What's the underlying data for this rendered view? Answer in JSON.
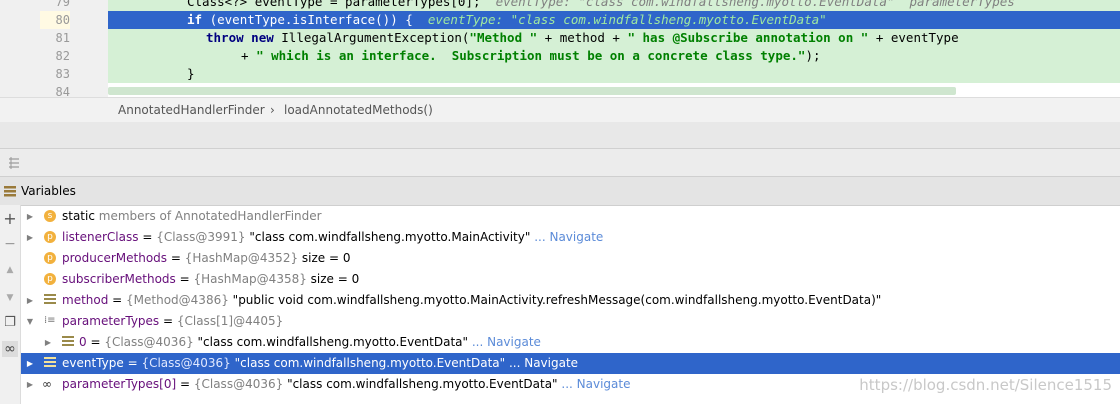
{
  "editor": {
    "lines": [
      {
        "num": "79",
        "code": "Class<?> eventType = parameterTypes[0];",
        "hint": "eventType: \"class com.windfallsheng.myotto.EventData\"  parameterTypes"
      },
      {
        "num": "80",
        "kw": "if",
        "code": " (eventType.isInterface()) {",
        "hint": "eventType: \"class com.windfallsheng.myotto.EventData\""
      },
      {
        "num": "81",
        "kw1": "throw",
        "kw2": "new",
        "pre": " IllegalArgumentException(",
        "s1": "\"Method \"",
        "mid": " + method + ",
        "s2": "\" has @Subscribe annotation on \"",
        "post": " + eventType"
      },
      {
        "num": "82",
        "pre": "+ ",
        "s1": "\" which is an interface.  Subscription must be on a concrete class type.\"",
        "post": ");"
      },
      {
        "num": "83",
        "code": "}"
      },
      {
        "num": "84",
        "code": ""
      }
    ]
  },
  "breadcrumb": {
    "class_name": "AnnotatedHandlerFinder",
    "separator": "›",
    "method_name": "loadAnnotatedMethods()"
  },
  "panel": {
    "title": "Variables"
  },
  "sidebar": {
    "add": "+",
    "remove": "−",
    "up": "▲",
    "down": "▼",
    "copy": "❐",
    "watch": "∞"
  },
  "variables": [
    {
      "icon": "s",
      "static_label": "static",
      "text": " members of AnnotatedHandlerFinder"
    },
    {
      "icon": "p",
      "name": "listenerClass",
      "eq": " = ",
      "ref": "{Class@3991}",
      "value": " \"class com.windfallsheng.myotto.MainActivity\"",
      "nav": " ... Navigate"
    },
    {
      "icon": "p",
      "name": "producerMethods",
      "eq": " = ",
      "ref": "{HashMap@4352}",
      "value": "  size = 0"
    },
    {
      "icon": "p",
      "name": "subscriberMethods",
      "eq": " = ",
      "ref": "{HashMap@4358}",
      "value": "  size = 0"
    },
    {
      "icon": "f",
      "name": "method",
      "eq": " = ",
      "ref": "{Method@4386}",
      "value": " \"public void com.windfallsheng.myotto.MainActivity.refreshMessage(com.windfallsheng.myotto.EventData)\""
    },
    {
      "icon": "arr",
      "name": "parameterTypes",
      "eq": " = ",
      "ref": "{Class[1]@4405}"
    },
    {
      "icon": "f",
      "name": "0",
      "eq": " = ",
      "ref": "{Class@4036}",
      "value": " \"class com.windfallsheng.myotto.EventData\"",
      "nav": " ... Navigate"
    },
    {
      "icon": "f",
      "name": "eventType",
      "eq": " = ",
      "ref": "{Class@4036}",
      "value": " \"class com.windfallsheng.myotto.EventData\"",
      "nav": " ... Navigate"
    },
    {
      "icon": "inf",
      "name": "parameterTypes[0]",
      "eq": " = ",
      "ref": "{Class@4036}",
      "value": " \"class com.windfallsheng.myotto.EventData\"",
      "nav": " ... Navigate"
    }
  ],
  "watermark": "https://blog.csdn.net/Silence1515"
}
